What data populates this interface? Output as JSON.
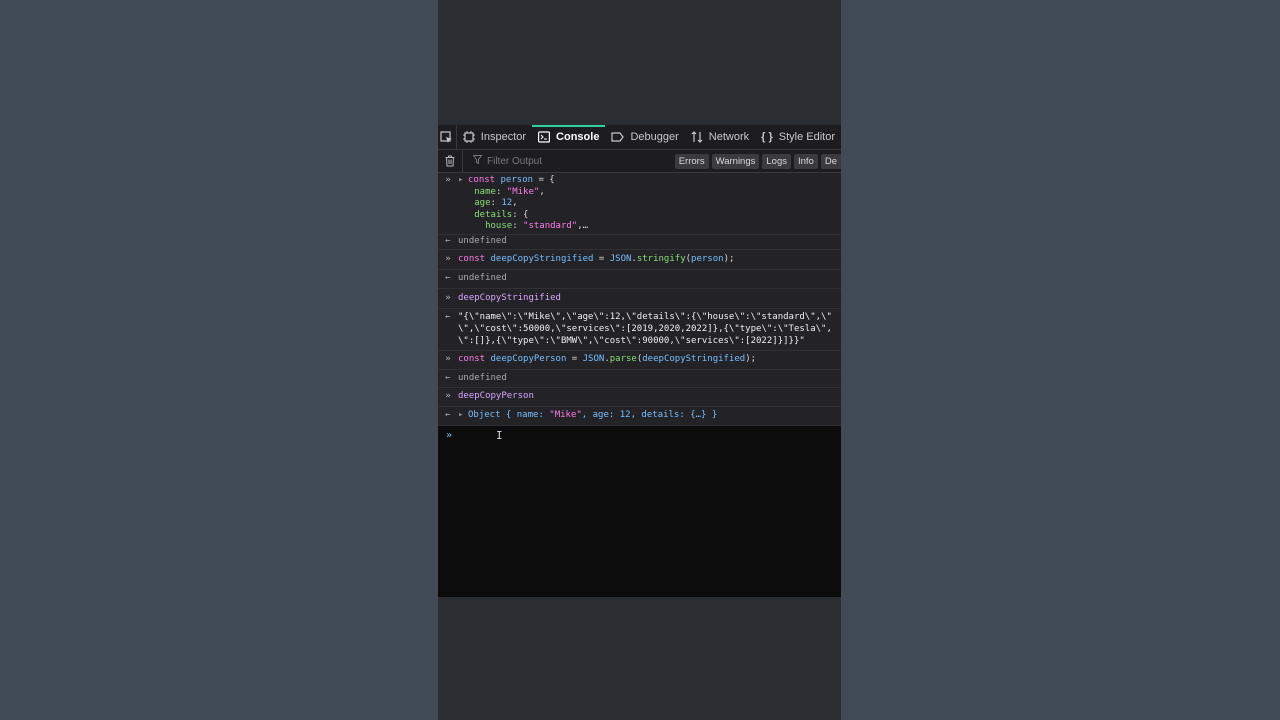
{
  "tabs": [
    {
      "label": "Inspector",
      "icon": "inspector-icon"
    },
    {
      "label": "Console",
      "icon": "console-icon"
    },
    {
      "label": "Debugger",
      "icon": "debugger-icon"
    },
    {
      "label": "Network",
      "icon": "network-icon"
    },
    {
      "label": "Style Editor",
      "icon": "style-editor-icon"
    }
  ],
  "filter": {
    "placeholder": "Filter Output"
  },
  "filter_buttons": [
    "Errors",
    "Warnings",
    "Logs",
    "Info",
    "De"
  ],
  "console": {
    "line1": {
      "kw": "const",
      "var": "person",
      "rest": " = {"
    },
    "line2": {
      "prop": "name",
      "sep": ": ",
      "val": "\"Mike\"",
      "end": ","
    },
    "line3": {
      "prop": "age",
      "sep": ": ",
      "val": "12",
      "end": ","
    },
    "line4": {
      "prop": "details",
      "rest": ": {"
    },
    "line5": {
      "prop": "house",
      "sep": ": ",
      "val": "\"standard\"",
      "end": ",…"
    },
    "out1": "undefined",
    "cmd2": {
      "kw": "const",
      "var": "deepCopyStringified",
      "eq": " = ",
      "obj": "JSON",
      "dot": ".",
      "fn": "stringify",
      "open": "(",
      "arg": "person",
      "close": ");"
    },
    "out2": "undefined",
    "cmd3": "deepCopyStringified",
    "res3_l1": "\"{\\\"name\\\":\\\"Mike\\\",\\\"age\\\":12,\\\"details\\\":{\\\"house\\\":\\\"standard\\\",\\\"",
    "res3_l2": "\\\",\\\"cost\\\":50000,\\\"services\\\":[2019,2020,2022]},{\\\"type\\\":\\\"Tesla\\\",",
    "res3_l3": "\\\":[]},{\\\"type\\\":\\\"BMW\\\",\\\"cost\\\":90000,\\\"services\\\":[2022]}]}}\"",
    "cmd4": {
      "kw": "const",
      "var": "deepCopyPerson",
      "eq": " = ",
      "obj": "JSON",
      "dot": ".",
      "fn": "parse",
      "open": "(",
      "arg": "deepCopyStringified",
      "close": ");"
    },
    "out4": "undefined",
    "cmd5": "deepCopyPerson",
    "res5": {
      "a": "Object { name: ",
      "b": "\"Mike\"",
      "c": ", age: ",
      "d": "12",
      "e": ", details: {…} }"
    }
  },
  "prompt_symbol": "»",
  "result_symbol": "←"
}
